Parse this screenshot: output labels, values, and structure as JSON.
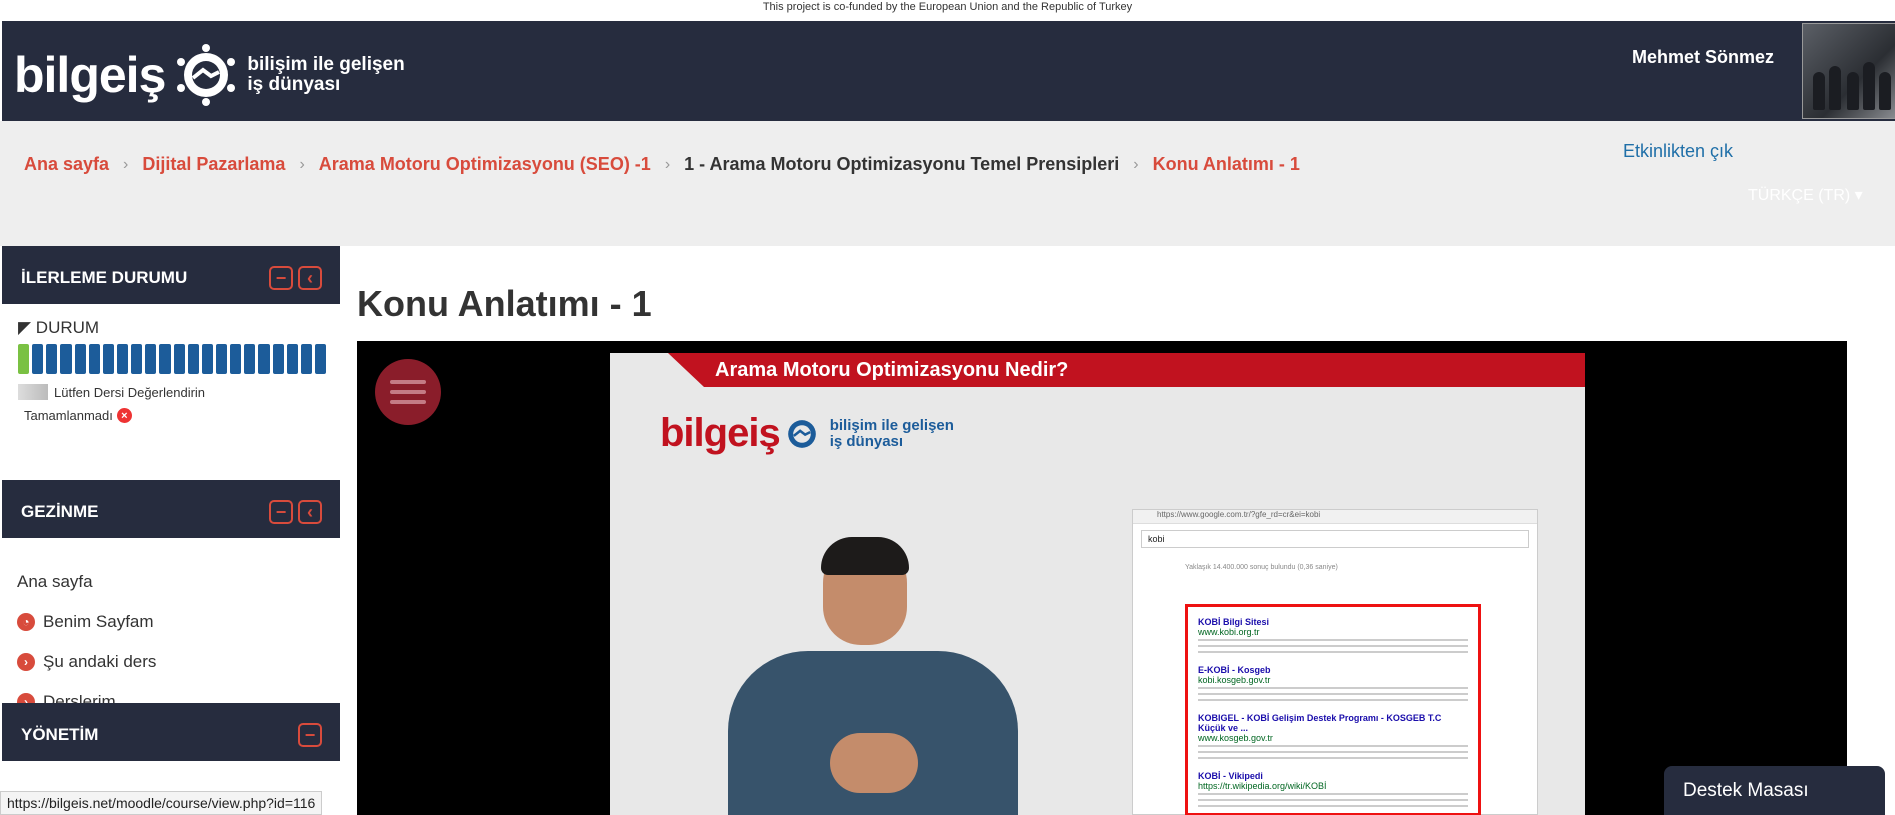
{
  "topstrip": "This project is co-funded by the European Union and the Republic of Turkey",
  "header": {
    "logo_word": "bilgeiş",
    "logo_tag_line1": "bilişim ile gelişen",
    "logo_tag_line2": "iş dünyası",
    "username": "Mehmet Sönmez"
  },
  "breadcrumb": [
    "Ana sayfa",
    "Dijital Pazarlama",
    "Arama Motoru Optimizasyonu (SEO) -1",
    "1 - Arama Motoru Optimizasyonu Temel Prensipleri",
    "Konu Anlatımı - 1"
  ],
  "exit_activity": "Etkinlikten çık",
  "language": "TÜRKÇE (TR) ▾",
  "progress_block": {
    "title": "İLERLEME DURUMU",
    "status_label": "DURUM",
    "segments_total": 22,
    "segments_done": 1,
    "lesson": "Lütfen Dersi Değerlendirin",
    "lesson_status": "Tamamlanmadı"
  },
  "navigation_block": {
    "title": "GEZİNME",
    "items": [
      "Ana sayfa",
      "Benim Sayfam",
      "Şu andaki ders",
      "Derslerim"
    ]
  },
  "admin_block": {
    "title": "YÖNETİM"
  },
  "page_title": "Konu Anlatımı - 1",
  "video": {
    "slide_title": "Arama Motoru Optimizasyonu Nedir?",
    "slide_logo_word": "bilgeiş",
    "slide_logo_line1": "bilişim ile gelişen",
    "slide_logo_line2": "iş dünyası",
    "browser_url": "https://www.google.com.tr/?gfe_rd=cr&ei=kobi",
    "search_query": "kobi",
    "results_count": "Yaklaşık 14.400.000 sonuç bulundu (0,36 saniye)",
    "results": [
      {
        "title": "KOBİ Bilgi Sitesi",
        "url": "www.kobi.org.tr"
      },
      {
        "title": "E-KOBİ - Kosgeb",
        "url": "kobi.kosgeb.gov.tr"
      },
      {
        "title": "KOBIGEL - KOBİ Gelişim Destek Programı - KOSGEB T.C Küçük ve ...",
        "url": "www.kosgeb.gov.tr"
      },
      {
        "title": "KOBİ - Vikipedi",
        "url": "https://tr.wikipedia.org/wiki/KOBİ"
      }
    ]
  },
  "status_url": "https://bilgeis.net/moodle/course/view.php?id=116",
  "help_desk": "Destek Masası",
  "colors": {
    "header_bg": "#262c3e",
    "accent": "#d84b3c",
    "progress": "#1c5c9a",
    "progress_done": "#7ac143"
  }
}
